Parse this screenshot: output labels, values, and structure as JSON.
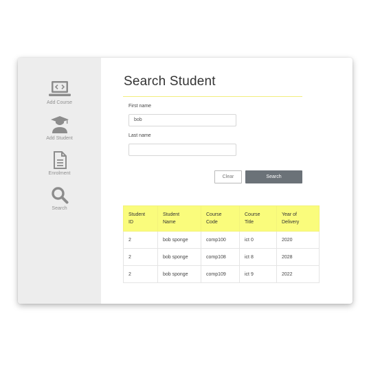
{
  "sidebar": {
    "items": [
      {
        "label": "Add Course",
        "icon": "laptop-code-icon"
      },
      {
        "label": "Add Student",
        "icon": "graduate-icon"
      },
      {
        "label": "Enrolment",
        "icon": "document-icon"
      },
      {
        "label": "Search",
        "icon": "magnifier-icon"
      }
    ]
  },
  "main": {
    "title": "Search Student",
    "first_name_label": "First name",
    "first_name_value": "bob",
    "last_name_label": "Last name",
    "last_name_value": "",
    "clear_label": "Clear",
    "search_label": "Search"
  },
  "table": {
    "headers": [
      [
        "Student",
        "ID"
      ],
      [
        "Student",
        "Name"
      ],
      [
        "Course",
        "Code"
      ],
      [
        "Course",
        "Title"
      ],
      [
        "Year of",
        "Delivery"
      ]
    ],
    "rows": [
      [
        "2",
        "bob sponge",
        "comp100",
        "ict 0",
        "2020"
      ],
      [
        "2",
        "bob sponge",
        "comp108",
        "ict 8",
        "2028"
      ],
      [
        "2",
        "bob sponge",
        "comp109",
        "ict 9",
        "2022"
      ]
    ]
  },
  "colors": {
    "accent_yellow": "#fafc7c",
    "button_dark": "#6b7278",
    "sidebar_bg": "#ededed",
    "icon_gray": "#8c8c8c"
  }
}
